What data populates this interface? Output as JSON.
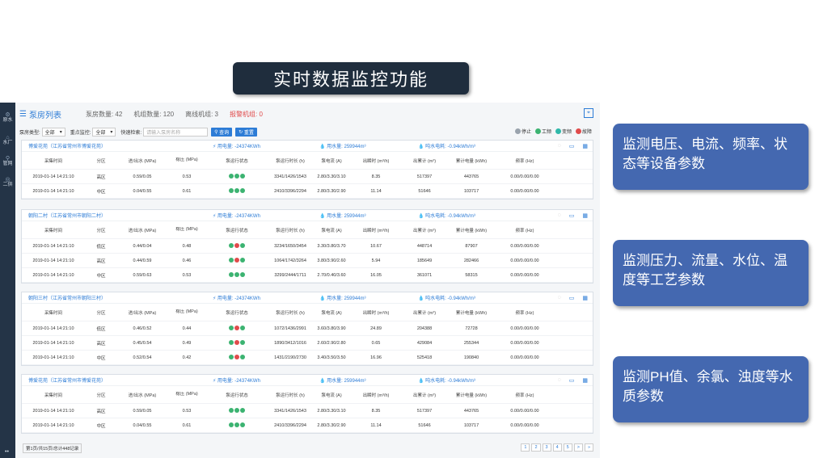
{
  "slide": {
    "title": "实时数据监控功能",
    "callouts": [
      "监测电压、电流、频率、状态等设备参数",
      "监测压力、流量、水位、温度等工艺参数",
      "监测PH值、余氯、浊度等水质参数"
    ]
  },
  "sidebar": {
    "items": [
      {
        "label": "原水",
        "icon": "gear-icon"
      },
      {
        "label": "水厂",
        "icon": "home-icon"
      },
      {
        "label": "管网",
        "icon": "network-icon"
      },
      {
        "label": "二供",
        "icon": "pump-icon"
      }
    ],
    "bottom": "••"
  },
  "header": {
    "title": "泵房列表",
    "stats": [
      "泵房数量: 42",
      "机组数量: 120",
      "离线机组: 3"
    ],
    "alarm": "报警机组: 0"
  },
  "filters": {
    "pump_type_label": "泵房类型:",
    "pump_type_value": "全部",
    "key_monitor_label": "重点监控:",
    "key_monitor_value": "全部",
    "quick_search_label": "快速检索:",
    "search_placeholder": "请输入泵房名称",
    "query_button": "查询",
    "reset_button": "重置",
    "legend": [
      "停止",
      "工频",
      "变频",
      "故障"
    ]
  },
  "columns": [
    "采集时间",
    "分区",
    "进/出水 (MPa)",
    "稳压 (MPa)",
    "泵运行状态",
    "泵运行时长 (h)",
    "泵电流 (A)",
    "出瞬时 (m³/h)",
    "出累计 (m³)",
    "累计电量 (kWh)",
    "频率 (Hz)"
  ],
  "stations": [
    {
      "name": "博爱花苑（江苏省常州市博爱花苑）",
      "power": "用电量: -24374KWh",
      "water": "用水量: 259944m³",
      "unit": "吨水电耗: -0.94kWh/m³",
      "rows": [
        [
          "2019-01-14 14:21:10",
          "高区",
          "0.59/0.05",
          "0.53",
          "3341/1426/1543",
          "2.80/3.30/3.10",
          "8.35",
          "517397",
          "443765",
          "0.00/0.00/0.00"
        ],
        [
          "2019-01-14 14:21:10",
          "中区",
          "0.04/0.55",
          "0.61",
          "2410/3396/2294",
          "2.80/3.30/2.90",
          "11.14",
          "51646",
          "103717",
          "0.00/0.00/0.00"
        ]
      ],
      "states": [
        [
          "green",
          "green",
          "green"
        ],
        [
          "green",
          "green",
          "green"
        ]
      ]
    },
    {
      "name": "朝阳二村（江苏省常州市朝阳二村）",
      "power": "用电量: -24374KWh",
      "water": "用水量: 259944m³",
      "unit": "吨水电耗: -0.94kWh/m³",
      "rows": [
        [
          "2019-01-14 14:21:10",
          "低区",
          "0.44/0.04",
          "0.48",
          "3234/1650/3454",
          "3.30/3.80/3.70",
          "10.67",
          "448714",
          "87907",
          "0.00/0.00/0.00"
        ],
        [
          "2019-01-14 14:21:10",
          "高区",
          "0.44/0.59",
          "0.46",
          "1064/1742/3264",
          "3.80/3.90/2.60",
          "5.94",
          "185649",
          "282466",
          "0.00/0.00/0.00"
        ],
        [
          "2019-01-14 14:21:10",
          "中区",
          "0.59/0.63",
          "0.53",
          "3299/2444/1711",
          "2.70/0.40/3.60",
          "16.05",
          "361071",
          "58315",
          "0.00/0.00/0.00"
        ]
      ],
      "states": [
        [
          "green",
          "red",
          "green"
        ],
        [
          "green",
          "red",
          "green"
        ],
        [
          "green",
          "green",
          "green"
        ]
      ]
    },
    {
      "name": "朝阳三村（江苏省常州市朝阳三村）",
      "power": "用电量: -24374KWh",
      "water": "用水量: 259944m³",
      "unit": "吨水电耗: -0.94kWh/m³",
      "rows": [
        [
          "2019-01-14 14:21:10",
          "低区",
          "0.46/0.52",
          "0.44",
          "1072/1436/2991",
          "3.60/3.80/3.90",
          "24.89",
          "204388",
          "72728",
          "0.00/0.00/0.00"
        ],
        [
          "2019-01-14 14:21:10",
          "高区",
          "0.45/0.54",
          "0.49",
          "1890/3412/1016",
          "2.60/2.90/2.80",
          "0.65",
          "429084",
          "255344",
          "0.00/0.00/0.00"
        ],
        [
          "2019-01-14 14:21:10",
          "中区",
          "0.52/0.54",
          "0.42",
          "1431/2190/2730",
          "3.40/3.50/3.50",
          "16.96",
          "525418",
          "190840",
          "0.00/0.00/0.00"
        ]
      ],
      "states": [
        [
          "green",
          "red",
          "green"
        ],
        [
          "green",
          "red",
          "green"
        ],
        [
          "green",
          "red",
          "green"
        ]
      ]
    },
    {
      "name": "博爱花苑（江苏省常州市博爱花苑）",
      "power": "用电量: -24374KWh",
      "water": "用水量: 259944m³",
      "unit": "吨水电耗: -0.94kWh/m³",
      "rows": [
        [
          "2019-01-14 14:21:10",
          "高区",
          "0.59/0.05",
          "0.53",
          "3341/1426/1543",
          "2.80/3.30/3.10",
          "8.35",
          "517397",
          "443765",
          "0.00/0.00/0.00"
        ],
        [
          "2019-01-14 14:21:10",
          "中区",
          "0.04/0.55",
          "0.61",
          "2410/3396/2294",
          "2.80/3.30/2.90",
          "11.14",
          "51646",
          "103717",
          "0.00/0.00/0.00"
        ]
      ],
      "states": [
        [
          "green",
          "green",
          "green"
        ],
        [
          "green",
          "green",
          "green"
        ]
      ]
    }
  ],
  "footer": {
    "info": "第1页/共15页/总计448记录",
    "pages": [
      "1",
      "2",
      "3",
      "4",
      "5",
      ">",
      "»"
    ]
  },
  "colors": {
    "accent": "#2d7cd6",
    "callout": "#4468b0",
    "title_bg": "#1f2d3d",
    "status_green": "#3cb371",
    "status_red": "#e04b4b"
  }
}
